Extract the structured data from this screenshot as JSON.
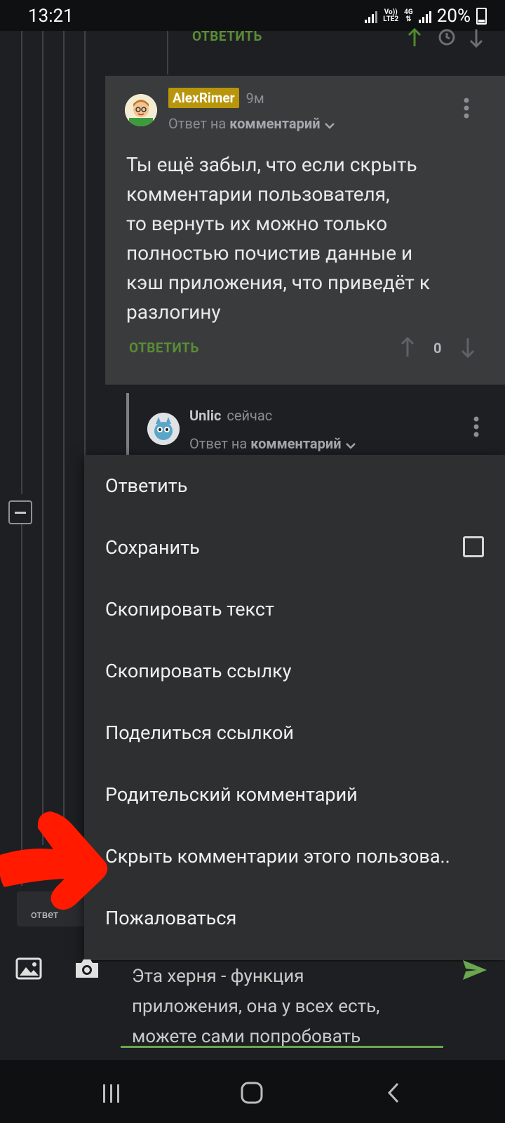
{
  "status_bar": {
    "time": "13:21",
    "network_top": "Vo))",
    "network_bottom": "LTE2",
    "network_type": "4G",
    "battery": "20%"
  },
  "top_partial": {
    "reply_label": "ОТВЕТИТЬ"
  },
  "comment": {
    "author": "AlexRimer",
    "time": "9м",
    "reply_to_prefix": "Ответ на",
    "reply_to_target": "комментарий",
    "text_lines": [
      "Ты ещё забыл, что если скрыть",
      "комментарии пользователя,",
      "то вернуть их можно только",
      "полностью почистив данные и",
      "кэш приложения, что приведёт к",
      "разлогину"
    ],
    "reply_label": "ОТВЕТИТЬ",
    "rating": "0"
  },
  "nested_comment": {
    "author": "Unlic",
    "time": "сейчас",
    "reply_to_prefix": "Ответ на",
    "reply_to_target": "комментарий"
  },
  "left_partial": {
    "reply_label": "ответ"
  },
  "context_menu": {
    "items": [
      "Ответить",
      "Сохранить",
      "Скопировать текст",
      "Скопировать ссылку",
      "Поделиться ссылкой",
      "Родительский комментарий",
      "Скрыть комментарии этого пользова..",
      "Пожаловаться"
    ]
  },
  "input": {
    "line1": "Эта херня - функция",
    "line2": "приложения, она у всех есть,",
    "line3": "можете сами попробовать"
  },
  "colors": {
    "background": "#1d1f22",
    "card": "#3a3b3d",
    "menu": "#2e2f31",
    "accent_green": "#5a8c36",
    "badge_gold": "#b8950b",
    "annotation_red": "#ff1a00"
  }
}
